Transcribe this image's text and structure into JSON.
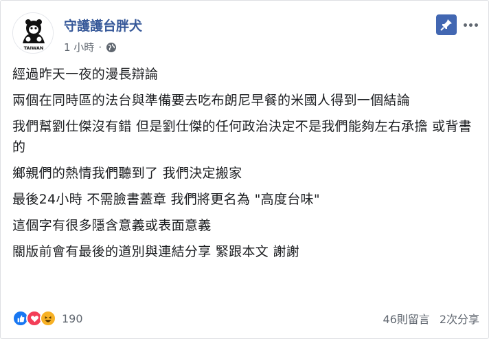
{
  "post": {
    "author": "守護護台胖犬",
    "timestamp": "1 小時",
    "separator": "·",
    "avatar_text": "TAIWAN",
    "paragraphs": [
      "經過昨天一夜的漫長辯論",
      "兩個在同時區的法台與準備要去吃布朗尼早餐的米國人得到一個結論",
      "我們幫劉仕傑沒有錯 但是劉仕傑的任何政治決定不是我們能夠左右承擔 或背書的",
      "鄉親們的熱情我們聽到了 我們決定搬家",
      "最後24小時 不需臉書蓋章 我們將更名為 \"高度台味\"",
      "這個字有很多隱含意義或表面意義",
      "關版前會有最後的道別與連結分享 緊跟本文 謝謝"
    ],
    "reactions_count": "190",
    "comments": "46則留言",
    "shares": "2次分享",
    "icons": {
      "pin": "pin-icon",
      "more": "more-icon",
      "privacy": "globe-icon",
      "like": "like-reaction-icon",
      "love": "love-reaction-icon",
      "haha": "haha-reaction-icon"
    },
    "colors": {
      "author": "#365899",
      "pin_bg": "#4267b2",
      "like": "#1877f2",
      "love": "#f33e58",
      "haha": "#f7b125"
    }
  }
}
